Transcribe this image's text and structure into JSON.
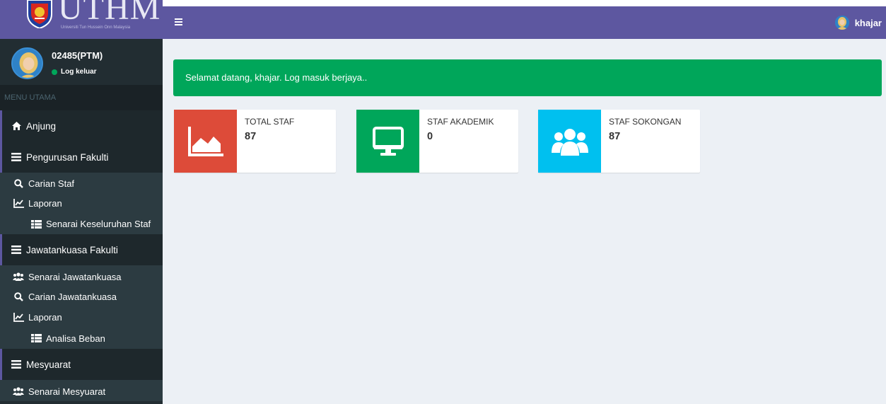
{
  "brand": {
    "logo_text": "UTHM",
    "logo_subtitle": "Universiti Tun Hussein Onn Malaysia"
  },
  "user": {
    "id": "02485(PTM)",
    "status": "Log keluar",
    "name": "khajar"
  },
  "sidebar": {
    "header": "MENU UTAMA",
    "items": [
      {
        "label": "Anjung",
        "icon": "home-icon"
      },
      {
        "label": "Pengurusan Fakulti",
        "icon": "list-icon"
      },
      {
        "label": "Carian Staf",
        "icon": "search-icon"
      },
      {
        "label": "Laporan",
        "icon": "line-chart-icon"
      },
      {
        "label": "Senarai Keseluruhan Staf",
        "icon": "table-icon"
      },
      {
        "label": "Jawatankuasa Fakulti",
        "icon": "list-icon"
      },
      {
        "label": "Senarai Jawatankuasa",
        "icon": "users-icon"
      },
      {
        "label": "Carian Jawatankuasa",
        "icon": "search-icon"
      },
      {
        "label": "Laporan",
        "icon": "line-chart-icon"
      },
      {
        "label": "Analisa Beban",
        "icon": "table-icon"
      },
      {
        "label": "Mesyuarat",
        "icon": "list-icon"
      },
      {
        "label": "Senarai Mesyuarat",
        "icon": "users-icon"
      }
    ]
  },
  "alert": {
    "message": "Selamat datang, khajar. Log masuk berjaya.."
  },
  "stats": [
    {
      "label": "TOTAL STAF",
      "value": "87",
      "color": "#dd4b39",
      "icon": "area-chart-icon"
    },
    {
      "label": "STAF AKADEMIK",
      "value": "0",
      "color": "#00a65a",
      "icon": "desktop-icon"
    },
    {
      "label": "STAF SOKONGAN",
      "value": "87",
      "color": "#00c0ef",
      "icon": "users-icon"
    }
  ],
  "colors": {
    "header": "#5d57a0",
    "sidebar": "#222d32",
    "success": "#00a65a"
  }
}
